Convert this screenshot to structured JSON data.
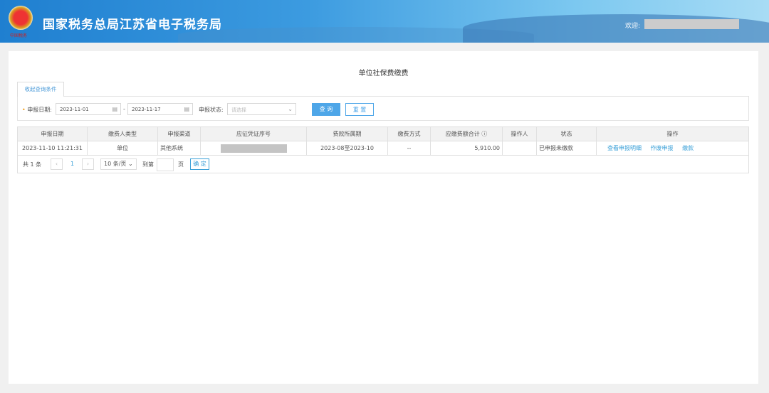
{
  "header": {
    "title": "国家税务总局江苏省电子税务局",
    "seal_text": "中国税务",
    "welcome": "欢迎:"
  },
  "page_title": "单位社保费缴费",
  "tab": "收起查询条件",
  "query": {
    "date_label": "申报日期:",
    "start_date": "2023-11-01",
    "end_date": "2023-11-17",
    "sep": "-",
    "status_label": "申报状态:",
    "status_placeholder": "请选择",
    "search": "查 询",
    "reset": "重 置"
  },
  "table": {
    "headers": [
      "申报日期",
      "缴费人类型",
      "申报渠道",
      "应征凭证序号",
      "费款所属期",
      "缴费方式",
      "应缴费额合计",
      "操作人",
      "状态",
      "操作"
    ],
    "rows": [
      {
        "date": "2023-11-10 11:21:31",
        "type": "单位",
        "channel": "其他系统",
        "period": "2023-08至2023-10",
        "method": "--",
        "amount": "5,910.00",
        "operator": "",
        "status": "已申报未缴款",
        "actions": [
          "查看申报明细",
          "作废申报",
          "缴款"
        ]
      }
    ]
  },
  "pager": {
    "total": "共 1 条",
    "page": "1",
    "size": "10 条/页",
    "goto": "到第",
    "page_unit": "页",
    "confirm": "确 定"
  }
}
